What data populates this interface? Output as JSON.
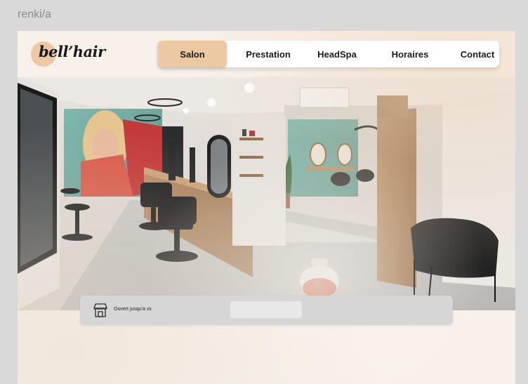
{
  "frame": {
    "label": "renki/a"
  },
  "brand": {
    "name": "bell’hair",
    "accent": "#ecc9a3"
  },
  "nav": {
    "items": [
      {
        "label": "Salon",
        "active": true
      },
      {
        "label": "Prestation",
        "active": false
      },
      {
        "label": "HeadSpa",
        "active": false
      },
      {
        "label": "Horaires",
        "active": false
      },
      {
        "label": "Contact",
        "active": false
      }
    ]
  },
  "hero": {
    "image_subject": "hair salon interior"
  },
  "info": {
    "status_text": "Ouvert jusqu'a xx",
    "icon": "shop-icon"
  }
}
